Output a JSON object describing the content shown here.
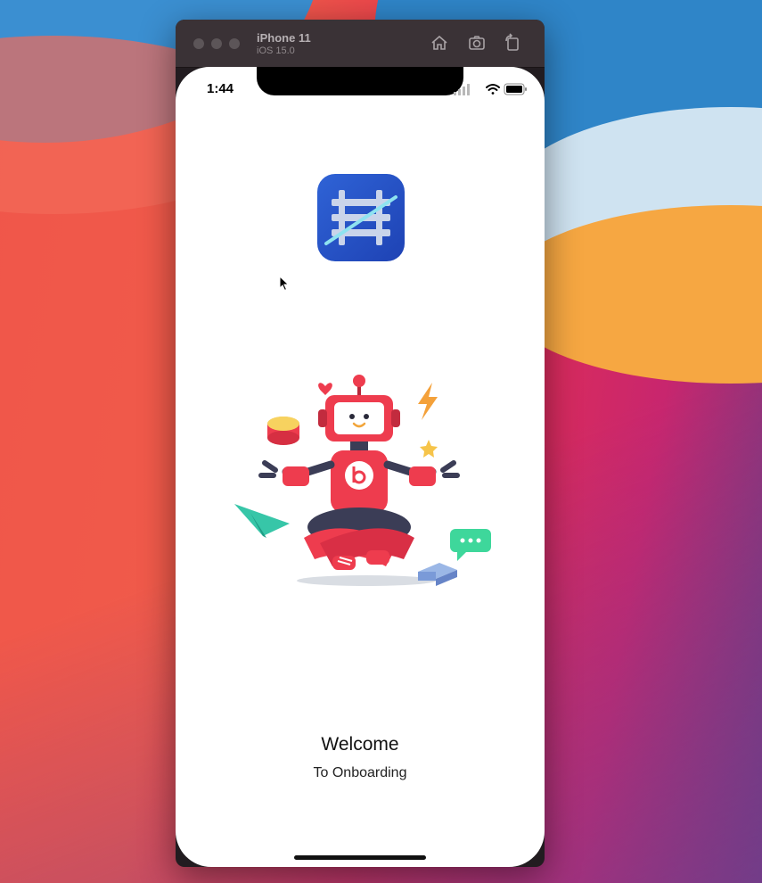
{
  "simulator": {
    "device": "iPhone 11",
    "os": "iOS 15.0",
    "toolbar_icons": [
      "home-icon",
      "screenshot-icon",
      "rotate-icon"
    ]
  },
  "status_bar": {
    "time": "1:44",
    "icons": [
      "signal-icon",
      "wifi-icon",
      "battery-icon"
    ]
  },
  "app": {
    "logo_icon": "railway-track-icon",
    "illustration": "robot-illustration"
  },
  "onboarding": {
    "title": "Welcome",
    "subtitle": "To Onboarding"
  },
  "colors": {
    "app_icon_blue": "#2a55c9",
    "robot_red": "#ee3c4e"
  }
}
